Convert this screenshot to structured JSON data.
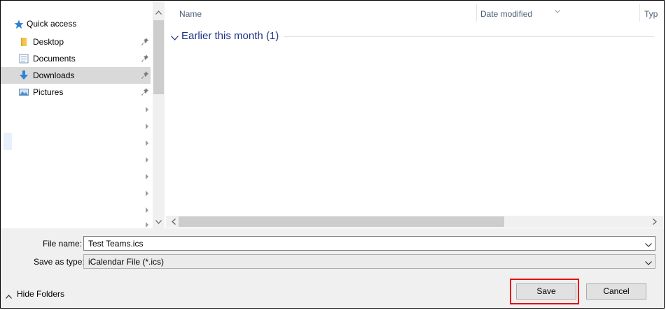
{
  "nav": {
    "quick_access": "Quick access",
    "items": [
      {
        "label": "Desktop"
      },
      {
        "label": "Documents"
      },
      {
        "label": "Downloads",
        "selected": true
      },
      {
        "label": "Pictures"
      }
    ]
  },
  "columns": {
    "name": "Name",
    "date_modified": "Date modified",
    "type": "Typ"
  },
  "file_list": {
    "group_label": "Earlier this month (1)"
  },
  "form": {
    "file_name_label": "File name:",
    "file_name_value": "Test Teams.ics",
    "save_type_label": "Save as type:",
    "save_type_value": "iCalendar File (*.ics)"
  },
  "actions": {
    "hide_folders": "Hide Folders",
    "save": "Save",
    "cancel": "Cancel"
  },
  "colors": {
    "highlight_border": "#e30000",
    "selected_row": "#d9d9d9",
    "group_heading": "#1e3287"
  }
}
